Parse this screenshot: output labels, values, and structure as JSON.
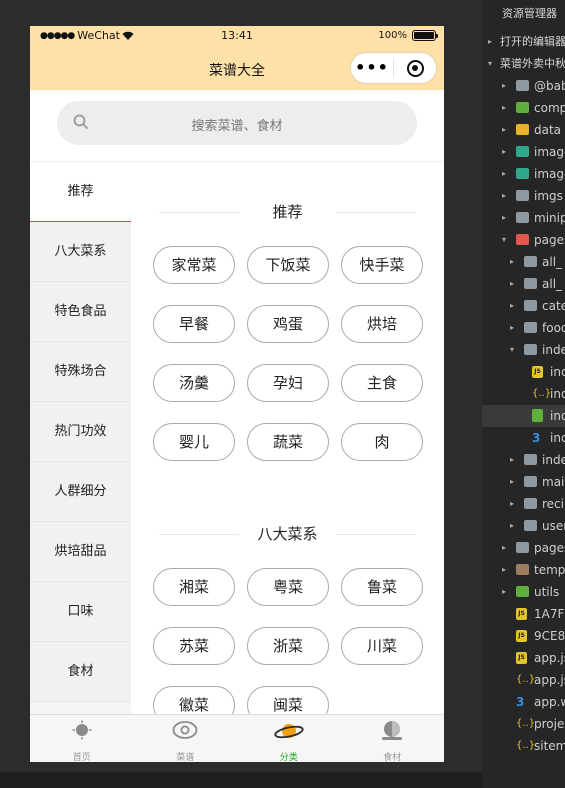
{
  "status_bar": {
    "carrier": "WeChat",
    "time": "13:41",
    "battery": "100%",
    "battery_level": 1.0
  },
  "navbar": {
    "title": "菜谱大全",
    "more_glyph": "•••"
  },
  "search": {
    "placeholder": "搜索菜谱、食材"
  },
  "sidebar": {
    "items": [
      "推荐",
      "八大菜系",
      "特色食品",
      "特殊场合",
      "热门功效",
      "人群细分",
      "烘培甜品",
      "口味",
      "食材"
    ],
    "active_index": 0
  },
  "sections": [
    {
      "title": "推荐",
      "tags": [
        "家常菜",
        "下饭菜",
        "快手菜",
        "早餐",
        "鸡蛋",
        "烘培",
        "汤羹",
        "孕妇",
        "主食",
        "婴儿",
        "蔬菜",
        "肉"
      ]
    },
    {
      "title": "八大菜系",
      "tags": [
        "湘菜",
        "粤菜",
        "鲁菜",
        "苏菜",
        "浙菜",
        "川菜",
        "徽菜",
        "闽菜"
      ]
    }
  ],
  "tabbar": [
    {
      "label": "首页",
      "icon": "home-icon",
      "active": false
    },
    {
      "label": "菜谱",
      "icon": "eye-icon",
      "active": false
    },
    {
      "label": "分类",
      "icon": "planet-icon",
      "active": true
    },
    {
      "label": "食材",
      "icon": "ingredient-icon",
      "active": false
    }
  ],
  "colors": {
    "nav_bg": "#ffe1a8",
    "active_tab": "#1aad19",
    "sidebar_active_line": "#d64a4a"
  },
  "ide": {
    "panel_title": "资源管理器",
    "rows": [
      {
        "label": "打开的编辑器",
        "type": "section",
        "arrow": "▸",
        "level": 0
      },
      {
        "label": "菜谱外卖中秋",
        "type": "section",
        "arrow": "▾",
        "level": 0
      },
      {
        "label": "@babel",
        "type": "folder",
        "arrow": "▸",
        "level": 1
      },
      {
        "label": "components",
        "type": "green",
        "arrow": "▸",
        "level": 1
      },
      {
        "label": "data",
        "type": "yellow",
        "arrow": "▸",
        "level": 1
      },
      {
        "label": "images",
        "type": "teal",
        "arrow": "▸",
        "level": 1
      },
      {
        "label": "images",
        "type": "teal",
        "arrow": "▸",
        "level": 1
      },
      {
        "label": "imgs",
        "type": "folder",
        "arrow": "▸",
        "level": 1
      },
      {
        "label": "miniprogram",
        "type": "folder",
        "arrow": "▸",
        "level": 1
      },
      {
        "label": "pages",
        "type": "red",
        "arrow": "▾",
        "level": 1
      },
      {
        "label": "all_",
        "type": "folder",
        "arrow": "▸",
        "level": 2
      },
      {
        "label": "all_",
        "type": "folder",
        "arrow": "▸",
        "level": 2
      },
      {
        "label": "cate",
        "type": "folder",
        "arrow": "▸",
        "level": 2
      },
      {
        "label": "food",
        "type": "folder",
        "arrow": "▸",
        "level": 2
      },
      {
        "label": "index",
        "type": "folder",
        "arrow": "▾",
        "level": 2
      },
      {
        "label": "index.js",
        "type": "js",
        "arrow": "",
        "level": 3
      },
      {
        "label": "index.json",
        "type": "json",
        "arrow": "",
        "level": 3
      },
      {
        "label": "index.wxml",
        "type": "wxml",
        "arrow": "",
        "level": 3,
        "selected": true
      },
      {
        "label": "index.wxss",
        "type": "wxss",
        "arrow": "",
        "level": 3
      },
      {
        "label": "index",
        "type": "folder",
        "arrow": "▸",
        "level": 2
      },
      {
        "label": "main",
        "type": "folder",
        "arrow": "▸",
        "level": 2
      },
      {
        "label": "recipe",
        "type": "folder",
        "arrow": "▸",
        "level": 2
      },
      {
        "label": "user",
        "type": "folder",
        "arrow": "▸",
        "level": 2
      },
      {
        "label": "pages",
        "type": "folder",
        "arrow": "▸",
        "level": 1
      },
      {
        "label": "template",
        "type": "brown",
        "arrow": "▸",
        "level": 1
      },
      {
        "label": "utils",
        "type": "green",
        "arrow": "▸",
        "level": 1
      },
      {
        "label": "1A7F",
        "type": "js",
        "arrow": "",
        "level": 1
      },
      {
        "label": "9CE8",
        "type": "js",
        "arrow": "",
        "level": 1
      },
      {
        "label": "app.js",
        "type": "js",
        "arrow": "",
        "level": 1
      },
      {
        "label": "app.json",
        "type": "json",
        "arrow": "",
        "level": 1
      },
      {
        "label": "app.wxss",
        "type": "wxss",
        "arrow": "",
        "level": 1
      },
      {
        "label": "project.config.json",
        "type": "json",
        "arrow": "",
        "level": 1
      },
      {
        "label": "sitemap.json",
        "type": "json",
        "arrow": "",
        "level": 1
      }
    ]
  }
}
